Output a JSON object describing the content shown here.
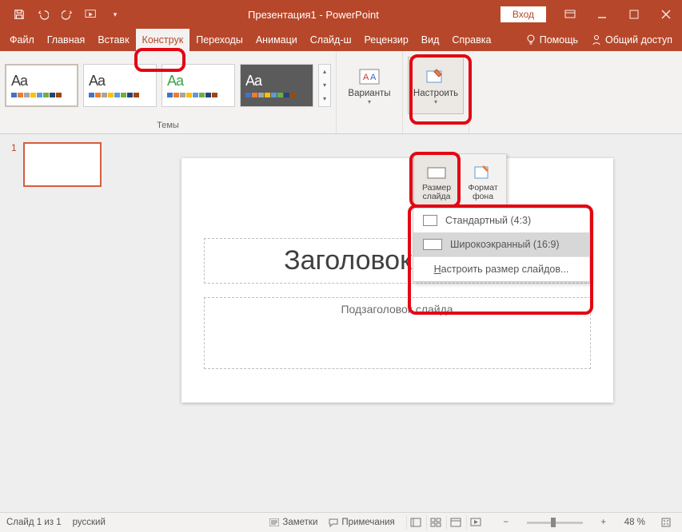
{
  "title": "Презентация1 - PowerPoint",
  "signin": "Вход",
  "tabs": {
    "file": "Файл",
    "home": "Главная",
    "insert": "Вставк",
    "design": "Конструк",
    "transitions": "Переходы",
    "animations": "Анимаци",
    "slideshow": "Слайд-ш",
    "review": "Рецензир",
    "view": "Вид",
    "help": "Справка",
    "tellme": "Помощь",
    "share": "Общий доступ"
  },
  "ribbon": {
    "themes_label": "Темы",
    "variants": "Варианты",
    "customize": "Настроить"
  },
  "slide_size_btn": "Размер\nслайда",
  "format_bg_btn": "Формат\nфона",
  "size_menu": {
    "standard": "Стандартный (4:3)",
    "widescreen": "Широкоэкранный (16:9)",
    "custom_prefix": "Н",
    "custom_rest": "астроить размер слайдов..."
  },
  "slide": {
    "title_placeholder": "Заголовок слайда",
    "subtitle_placeholder": "Подзаголовок слайда"
  },
  "thumb": {
    "num": "1"
  },
  "status": {
    "slide_of": "Слайд 1 из 1",
    "lang": "русский",
    "notes": "Заметки",
    "comments": "Примечания",
    "zoom": "48 %"
  },
  "theme_thumbs": [
    {
      "aa_color": "#3b3b3b",
      "bg": "#ffffff"
    },
    {
      "aa_color": "#3b3b3b",
      "bg": "#ffffff"
    },
    {
      "aa_color": "#3aa24a",
      "bg": "#ffffff"
    },
    {
      "aa_color": "#ffffff",
      "bg": "#5b5b5b"
    }
  ],
  "swatch_colors": [
    "#4472c4",
    "#ed7d31",
    "#a5a5a5",
    "#ffc000",
    "#5b9bd5",
    "#70ad47",
    "#264478",
    "#9e480e"
  ]
}
